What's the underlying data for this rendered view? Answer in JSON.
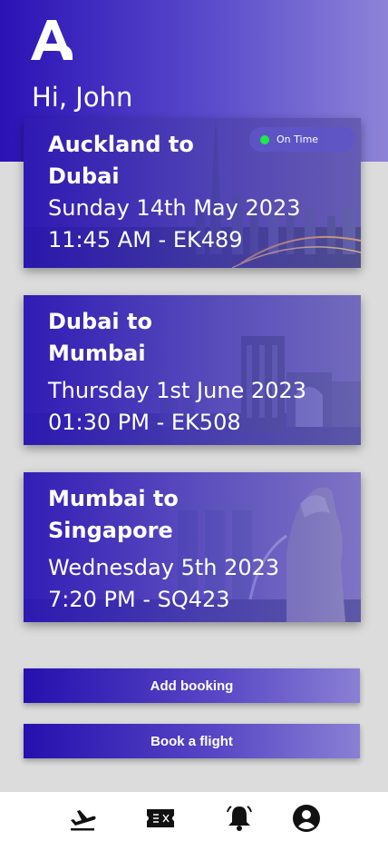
{
  "header": {
    "logo_letter": "A",
    "greeting": "Hi, John",
    "brand_color": "#2a12b5"
  },
  "trips": [
    {
      "route_line1": "Auckland to",
      "route_line2": "Dubai",
      "date": "Sunday 14th May 2023",
      "time_flight": "11:45 AM - EK489",
      "status": "On Time",
      "status_color": "#1ee84a",
      "background": "dubai-skyline"
    },
    {
      "route_line1": "Dubai to",
      "route_line2": "Mumbai",
      "date": "Thursday 1st June 2023",
      "time_flight": "01:30 PM - EK508",
      "background": "mumbai-gateway"
    },
    {
      "route_line1": "Mumbai to",
      "route_line2": "Singapore",
      "date": "Wednesday 5th 2023",
      "time_flight": "7:20 PM - SQ423",
      "background": "singapore-merlion"
    }
  ],
  "actions": {
    "add_booking": "Add booking",
    "book_flight": "Book a flight"
  },
  "nav": [
    {
      "name": "flight-departure-icon"
    },
    {
      "name": "ticket-icon"
    },
    {
      "name": "bell-icon"
    },
    {
      "name": "profile-icon"
    }
  ]
}
